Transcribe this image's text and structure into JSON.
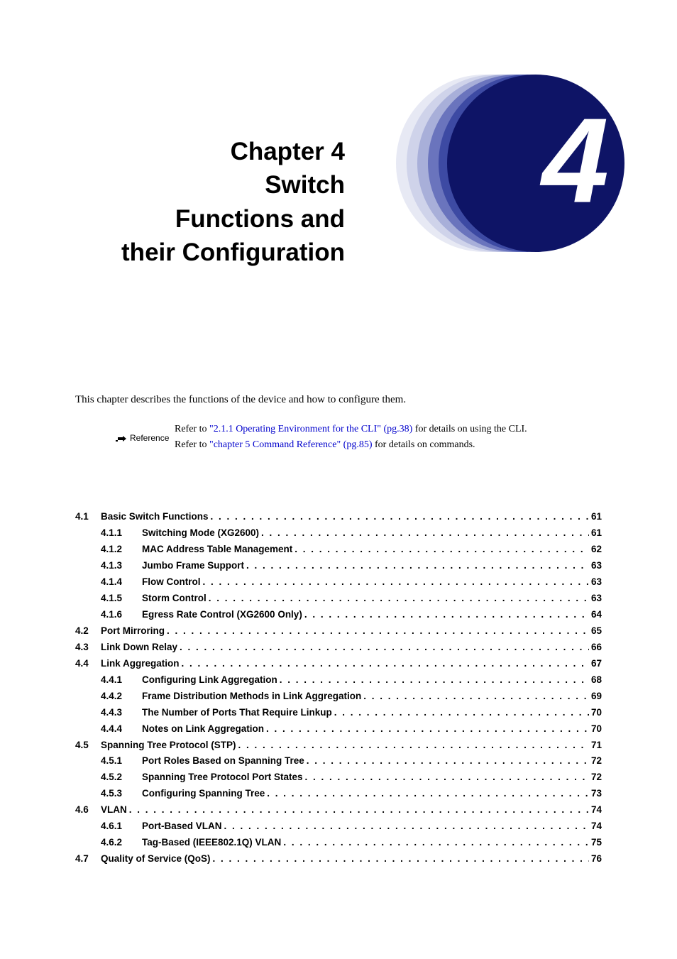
{
  "chapter": {
    "number": "4",
    "title_line1": "Chapter 4",
    "title_line2": "Switch",
    "title_line3": "Functions and",
    "title_line4": "their Configuration"
  },
  "intro": "This chapter describes the functions of the device and how to configure them.",
  "reference": {
    "label": "Reference",
    "line1_pre": "Refer to ",
    "line1_link": "\"2.1.1 Operating Environment for the CLI\" (pg.38)",
    "line1_post": " for details on using the CLI.",
    "line2_pre": "Refer to ",
    "line2_link": "\"chapter 5 Command Reference\" (pg.85)",
    "line2_post": " for details on commands."
  },
  "toc": [
    {
      "num": "4.1",
      "title": "Basic Switch Functions",
      "page": "61",
      "level": 1
    },
    {
      "num": "4.1.1",
      "title": "Switching Mode (XG2600)",
      "page": "61",
      "level": 2
    },
    {
      "num": "4.1.2",
      "title": "MAC Address Table Management",
      "page": "62",
      "level": 2
    },
    {
      "num": "4.1.3",
      "title": "Jumbo Frame Support",
      "page": "63",
      "level": 2
    },
    {
      "num": "4.1.4",
      "title": "Flow Control",
      "page": "63",
      "level": 2
    },
    {
      "num": "4.1.5",
      "title": "Storm Control",
      "page": "63",
      "level": 2
    },
    {
      "num": "4.1.6",
      "title": "Egress Rate Control (XG2600 Only)",
      "page": "64",
      "level": 2
    },
    {
      "num": "4.2",
      "title": "Port Mirroring",
      "page": "65",
      "level": 1
    },
    {
      "num": "4.3",
      "title": "Link Down Relay",
      "page": "66",
      "level": 1
    },
    {
      "num": "4.4",
      "title": "Link Aggregation",
      "page": "67",
      "level": 1
    },
    {
      "num": "4.4.1",
      "title": "Configuring Link Aggregation",
      "page": "68",
      "level": 2
    },
    {
      "num": "4.4.2",
      "title": "Frame Distribution Methods in Link Aggregation",
      "page": "69",
      "level": 2
    },
    {
      "num": "4.4.3",
      "title": "The Number of Ports That Require Linkup",
      "page": "70",
      "level": 2
    },
    {
      "num": "4.4.4",
      "title": "Notes on Link Aggregation",
      "page": "70",
      "level": 2
    },
    {
      "num": "4.5",
      "title": "Spanning Tree Protocol (STP)",
      "page": "71",
      "level": 1
    },
    {
      "num": "4.5.1",
      "title": "Port Roles Based on Spanning Tree",
      "page": "72",
      "level": 2
    },
    {
      "num": "4.5.2",
      "title": "Spanning Tree Protocol Port States",
      "page": "72",
      "level": 2
    },
    {
      "num": "4.5.3",
      "title": "Configuring Spanning Tree",
      "page": "73",
      "level": 2
    },
    {
      "num": "4.6",
      "title": "VLAN",
      "page": "74",
      "level": 1
    },
    {
      "num": "4.6.1",
      "title": "Port-Based VLAN",
      "page": "74",
      "level": 2
    },
    {
      "num": "4.6.2",
      "title": "Tag-Based (IEEE802.1Q) VLAN",
      "page": "75",
      "level": 2
    },
    {
      "num": "4.7",
      "title": "Quality of Service (QoS)",
      "page": "76",
      "level": 1
    }
  ]
}
